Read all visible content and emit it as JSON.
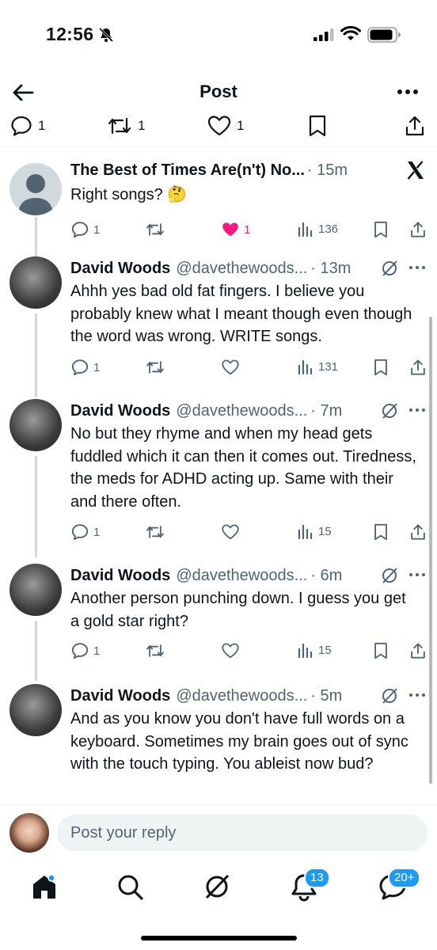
{
  "status_bar": {
    "time": "12:56"
  },
  "header": {
    "title": "Post"
  },
  "post_stats": {
    "replies": "1",
    "reposts": "1",
    "likes": "1"
  },
  "thread": [
    {
      "name": "The Best of Times Are(n't) No...",
      "handle": "",
      "time": "· 15m",
      "text": "Right songs? 🤔",
      "replies": "1",
      "reposts": "",
      "likes": "1",
      "liked": true,
      "views": "136",
      "header_icon": "x-logo-icon"
    },
    {
      "name": "David Woods",
      "handle": "@davethewoods...",
      "time": "· 13m",
      "text": "Ahhh yes bad old fat fingers. I believe you probably knew what I meant though even though the word was wrong. WRITE songs.",
      "replies": "1",
      "reposts": "",
      "likes": "",
      "liked": false,
      "views": "131",
      "header_icon": "grok-icon"
    },
    {
      "name": "David Woods",
      "handle": "@davethewoods...",
      "time": "· 7m",
      "text": "No but they rhyme and when my head gets fuddled which it can then it comes out. Tiredness, the meds for ADHD acting up. Same with their and there often.",
      "replies": "1",
      "reposts": "",
      "likes": "",
      "liked": false,
      "views": "15",
      "header_icon": "grok-icon"
    },
    {
      "name": "David Woods",
      "handle": "@davethewoods...",
      "time": "· 6m",
      "text": "Another person punching down. I guess you get a gold star right?",
      "replies": "1",
      "reposts": "",
      "likes": "",
      "liked": false,
      "views": "15",
      "header_icon": "grok-icon"
    },
    {
      "name": "David Woods",
      "handle": "@davethewoods...",
      "time": "· 5m",
      "text": "And as you know you don't have full words on a keyboard. Sometimes my brain goes out of sync with the touch typing. You ableist now bud?",
      "header_icon": "grok-icon"
    }
  ],
  "reply": {
    "placeholder": "Post your reply"
  },
  "nav": {
    "notifications_badge": "13",
    "messages_badge": "20+"
  },
  "colors": {
    "like": "#f91880",
    "accent": "#1d9bf0",
    "text": "#0f1419",
    "secondary": "#536471"
  }
}
